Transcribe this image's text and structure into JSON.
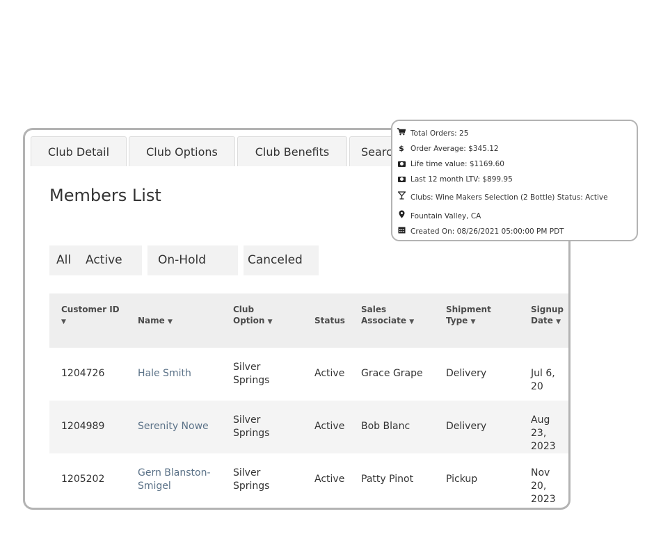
{
  "tabs": [
    "Club Detail",
    "Club Options",
    "Club Benefits",
    "Search"
  ],
  "page_title": "Members List",
  "filters": [
    "All",
    "Active",
    "On-Hold",
    "Canceled"
  ],
  "table": {
    "headers": {
      "customer_id": "Customer ID",
      "name": "Name",
      "club_option_1": "Club",
      "club_option_2": "Option",
      "status": "Status",
      "sales_1": "Sales",
      "sales_2": "Associate",
      "shipment_1": "Shipment",
      "shipment_2": "Type",
      "signup_1": "Signup",
      "signup_2": "Date"
    },
    "rows": [
      {
        "id": "1204726",
        "name_1": "Hale Smith",
        "name_2": "",
        "option_1": "Silver",
        "option_2": "Springs",
        "status": "Active",
        "sales": "Grace Grape",
        "shipment": "Delivery",
        "date_1": "Jul 6, 20",
        "date_2": ""
      },
      {
        "id": "1204989",
        "name_1": "Serenity Nowe",
        "name_2": "",
        "option_1": "Silver",
        "option_2": "Springs",
        "status": "Active",
        "sales": "Bob Blanc",
        "shipment": "Delivery",
        "date_1": "Aug 23,",
        "date_2": "2023"
      },
      {
        "id": "1205202",
        "name_1": "Gern Blanston-",
        "name_2": "Smigel",
        "option_1": "Silver",
        "option_2": "Springs",
        "status": "Active",
        "sales": "Patty Pinot",
        "shipment": "Pickup",
        "date_1": "Nov 20,",
        "date_2": "2023"
      }
    ]
  },
  "tooltip": {
    "total_orders": "Total Orders: 25",
    "order_average": "Order Average: $345.12",
    "lifetime_value": "Life time value: $1169.60",
    "last12_ltv": "Last 12 month LTV: $899.95",
    "clubs": "Clubs:  Wine Makers Selection (2 Bottle) Status: Active",
    "location": "Fountain Valley, CA",
    "created_on": "Created On: 08/26/2021 05:00:00 PM PDT",
    "icons": [
      "cart-icon",
      "dollar-icon",
      "cash-icon",
      "cash-icon",
      "cocktail-glass-icon",
      "map-marker-icon",
      "calendar-icon"
    ]
  }
}
